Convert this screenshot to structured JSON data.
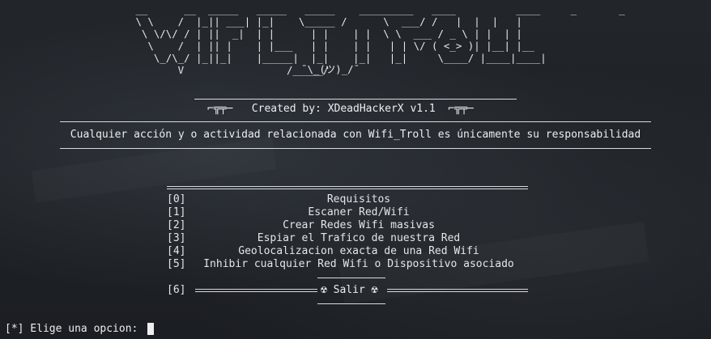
{
  "banner": {
    "ascii_art": " __      __  _____   _____   _____    _________   ____          ____     _       _\n \\ \\    /  |_|| ___| |_|    \\_____ /      \\  ___/ /   |  |  |   |\n  \\ \\/\\/ / | ||  _|  | |      | |    | |  \\ \\  ___ / _ \\ | |  | |\n   \\    /  | || |    | |___   | |    | |   | | \\/ ( <_> )| |__| |__\n    \\_/\\_/ |_||_|    |_____|  |_|    |_|   |_|     \\____/ |____|____|\n        V                 /_____/",
    "kaomoji": "¯\\_(ツ)_/¯"
  },
  "credit": {
    "text": "⌐╦╤─   Created by: XDeadHackerX v1.1  ⌐╦╤─"
  },
  "disclaimer": {
    "text": "Cualquier acción y o actividad relacionada con Wifi_Troll es únicamente su responsabilidad"
  },
  "menu": {
    "items": [
      {
        "num": "[0]",
        "label": "Requisitos"
      },
      {
        "num": "[1]",
        "label": "Escaner Red/Wifi"
      },
      {
        "num": "[2]",
        "label": "Crear Redes Wifi masivas"
      },
      {
        "num": "[3]",
        "label": "Espiar el Trafico de nuestra Red"
      },
      {
        "num": "[4]",
        "label": "Geolocalizacion exacta de una Red Wifi"
      },
      {
        "num": "[5]",
        "label": "Inhibir cualquier Red Wifi o Dispositivo asociado"
      }
    ],
    "exit": {
      "num": "[6]",
      "label": "☢ Salir ☢"
    }
  },
  "prompt": {
    "text": "[*] Elige una opcion: "
  },
  "colors": {
    "background": "#1c1f24",
    "foreground": "#eceef0"
  }
}
